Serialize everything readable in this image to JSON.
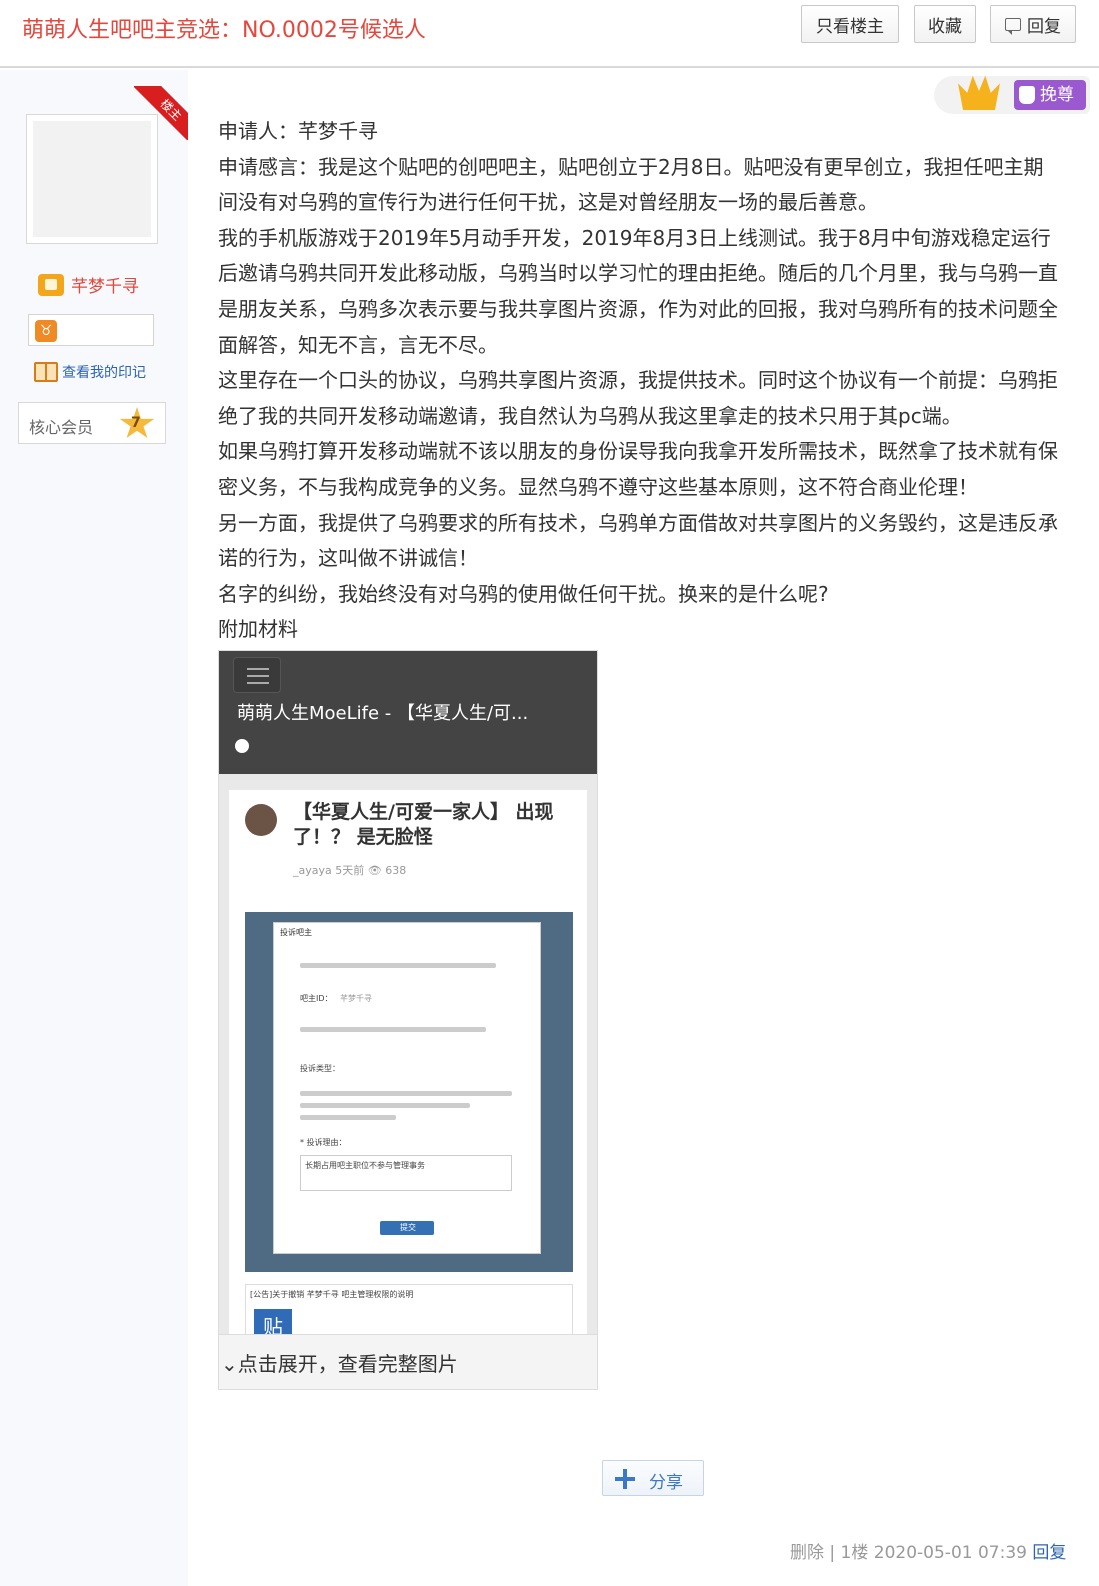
{
  "header": {
    "title": "萌萌人生吧吧主竞选：NO.0002号候选人",
    "btn_louzhu": "只看楼主",
    "btn_fav": "收藏",
    "btn_reply": "回复"
  },
  "author": {
    "ribbon": "楼主",
    "name": "芊梦千寻",
    "badge_sign": "♉",
    "yinji": "查看我的印记",
    "member_label": "核心会员",
    "member_level": "7"
  },
  "vip_tag": "挽尊",
  "post": {
    "paragraphs": [
      "申请人：芊梦千寻",
      "申请感言：我是这个贴吧的创吧吧主，贴吧创立于2月8日。贴吧没有更早创立，我担任吧主期间没有对乌鸦的宣传行为进行任何干扰，这是对曾经朋友一场的最后善意。",
      "我的手机版游戏于2019年5月动手开发，2019年8月3日上线测试。我于8月中旬游戏稳定运行后邀请乌鸦共同开发此移动版，乌鸦当时以学习忙的理由拒绝。随后的几个月里，我与乌鸦一直是朋友关系，乌鸦多次表示要与我共享图片资源，作为对此的回报，我对乌鸦所有的技术问题全面解答，知无不言，言无不尽。",
      "这里存在一个口头的协议，乌鸦共享图片资源，我提供技术。同时这个协议有一个前提：乌鸦拒绝了我的共同开发移动端邀请，我自然认为乌鸦从我这里拿走的技术只用于其pc端。",
      "如果乌鸦打算开发移动端就不该以朋友的身份误导我向我拿开发所需技术，既然拿了技术就有保密义务，不与我构成竞争的义务。显然乌鸦不遵守这些基本原则，这不符合商业伦理！",
      "另一方面，我提供了乌鸦要求的所有技术，乌鸦单方面借故对共享图片的义务毁约，这是违反承诺的行为，这叫做不讲诚信！",
      "名字的纠纷，我始终没有对乌鸦的使用做任何干扰。换来的是什么呢?",
      "附加材料"
    ]
  },
  "attachment": {
    "site_title": "萌萌人生MoeLife - 【华夏人生/可...",
    "card_title": "【华夏人生/可爱一家人】 出现了！？ 是无脸怪",
    "card_meta": "_ayaya   5天前   👁 638",
    "dialog_title": "投诉吧主",
    "dialog_id_label": "吧主ID：",
    "dialog_id_value": "芊梦千寻",
    "dialog_type_label": "投诉类型：",
    "dialog_reason_label": "* 投诉理由：",
    "dialog_reason_text": "长期占用吧主职位不参与管理事务",
    "dialog_submit": "提交",
    "bottom_title": "[公告]关于撤销 芊梦千寻 吧主管理权限的说明",
    "tie_icon": "贴",
    "expand": "⌄点击展开，查看完整图片"
  },
  "share": {
    "label": "分享"
  },
  "tail": {
    "delete": "删除",
    "sep": " | ",
    "floor": "1楼",
    "time": "2020-05-01 07:39",
    "reply": "回复"
  }
}
